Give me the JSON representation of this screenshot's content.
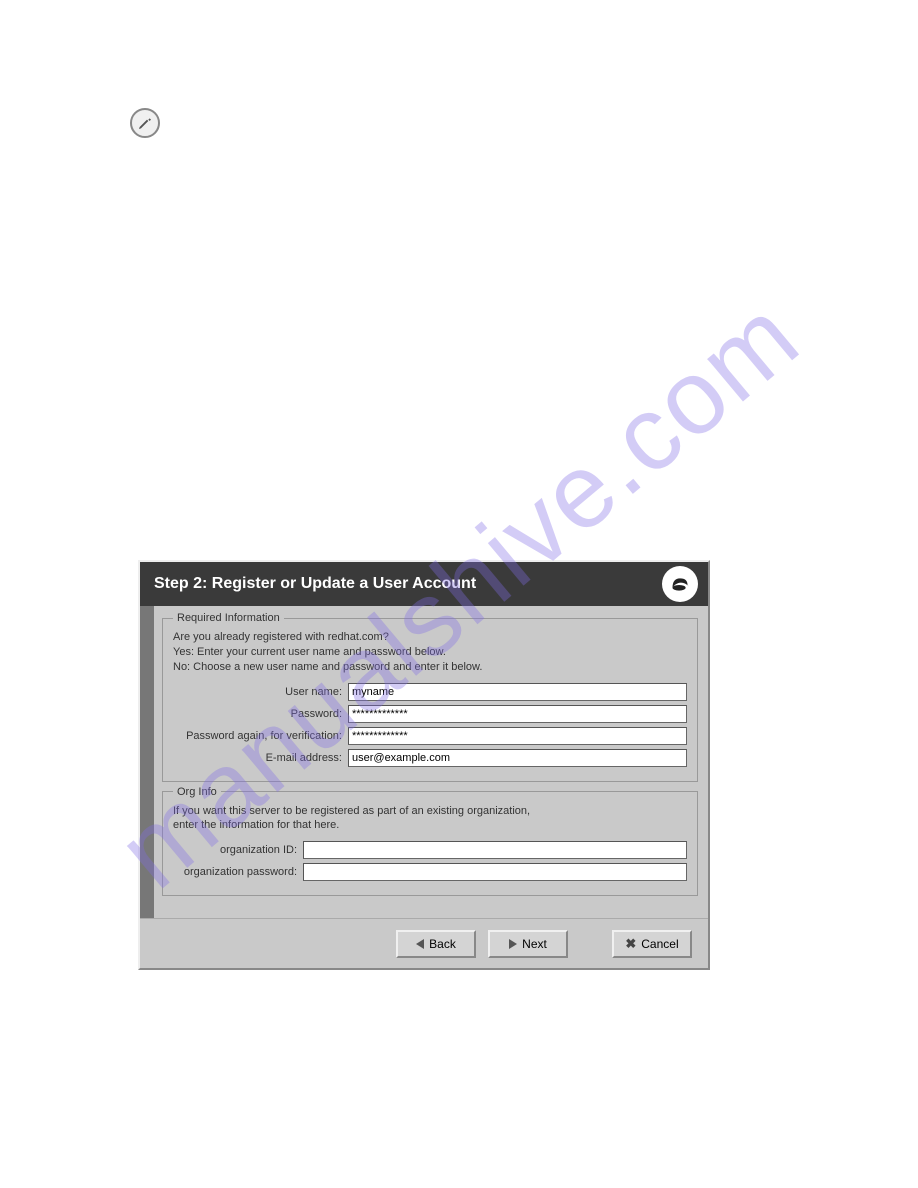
{
  "watermark": "manualshive.com",
  "dialog": {
    "title": "Step 2: Register or Update a User Account",
    "required": {
      "legend": "Required Information",
      "help1": "Are you already registered with redhat.com?",
      "help2": "Yes: Enter your current user name and password below.",
      "help3": "No: Choose a new user name and password and enter it below.",
      "username_label": "User name:",
      "username_value": "myname",
      "password_label": "Password:",
      "password_value": "*************",
      "password2_label": "Password again, for verification:",
      "password2_value": "*************",
      "email_label": "E-mail address:",
      "email_value": "user@example.com"
    },
    "org": {
      "legend": "Org Info",
      "help1": "If you want this server to be registered as part of an existing organization,",
      "help2": "enter the information for that here.",
      "orgid_label": "organization ID:",
      "orgid_value": "",
      "orgpw_label": "organization password:",
      "orgpw_value": ""
    },
    "buttons": {
      "back": "Back",
      "next": "Next",
      "cancel": "Cancel"
    }
  }
}
